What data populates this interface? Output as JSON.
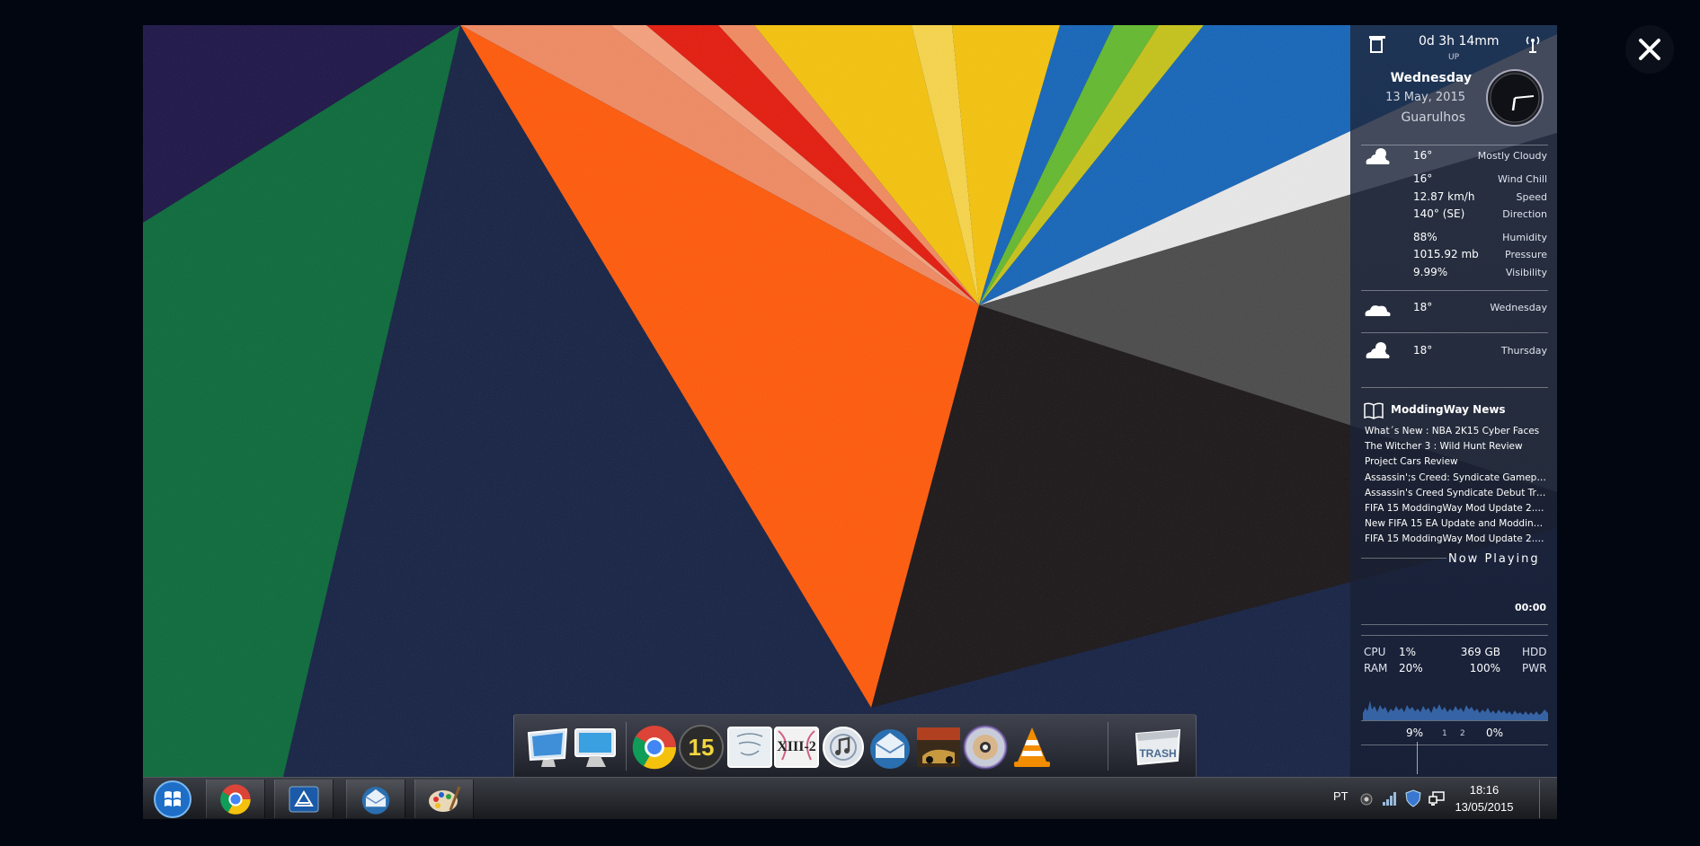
{
  "close_label": "✕",
  "sidebar": {
    "uptime": "0d 3h 14mm",
    "uptime_label": "UP",
    "day": "Wednesday",
    "date": "13 May, 2015",
    "city": "Guarulhos",
    "weather": {
      "temp": "16°",
      "condition": "Mostly Cloudy",
      "details": [
        {
          "value": "16°",
          "label": "Wind Chill"
        },
        {
          "value": "12.87 km/h",
          "label": "Speed"
        },
        {
          "value": "140° (SE)",
          "label": "Direction"
        },
        {
          "value": "88%",
          "label": "Humidity"
        },
        {
          "value": "1015.92 mb",
          "label": "Pressure"
        },
        {
          "value": "9.99%",
          "label": "Visibility"
        }
      ],
      "forecast": [
        {
          "temp": "18°",
          "day": "Wednesday"
        },
        {
          "temp": "18°",
          "day": "Thursday"
        }
      ]
    },
    "news": {
      "title": "ModdingWay News",
      "items": [
        "What´s New : NBA 2K15 Cyber Faces",
        "The Witcher 3 : Wild Hunt Review",
        "Project Cars Review",
        "Assassin';s Creed: Syndicate Gameplay...",
        "Assassin's Creed Syndicate Debut Trailer",
        "FIFA 15 ModdingWay Mod Update 2.0.2...",
        "New FIFA 15 EA Update and ModdingW...",
        "FIFA 15 ModdingWay Mod Update 2.0.0..."
      ]
    },
    "now_playing": "Now Playing",
    "time_elapsed": "00:00",
    "system": {
      "cpu_label": "CPU",
      "cpu_value": "1%",
      "ram_label": "RAM",
      "ram_value": "20%",
      "hdd_value": "369 GB",
      "hdd_label": "HDD",
      "pwr_value": "100%",
      "pwr_label": "PWR",
      "core1_value": "9%",
      "core1_label": "1",
      "core2_label": "2",
      "core2_value": "0%"
    }
  },
  "dock": {
    "trash_label": "TRASH",
    "icons": [
      "monitor-icon",
      "desktop-icon",
      "chrome-icon",
      "fifa-15-icon",
      "final-fantasy-icon",
      "xiii-2-icon",
      "itunes-icon",
      "mail-icon",
      "dirt-icon",
      "dvd-icon",
      "vlc-icon",
      "trash-icon"
    ],
    "fifa_label": "15",
    "xiii_label": "XIII-2"
  },
  "taskbar": {
    "language": "PT",
    "time": "18:16",
    "date": "13/05/2015"
  },
  "colors": {
    "orange": "#ff5a0a",
    "navy": "#162244",
    "green": "#0a6a39",
    "yellow": "#f4c20d",
    "red": "#e31b0d",
    "blue": "#1565b8",
    "lime": "#63b92f"
  }
}
